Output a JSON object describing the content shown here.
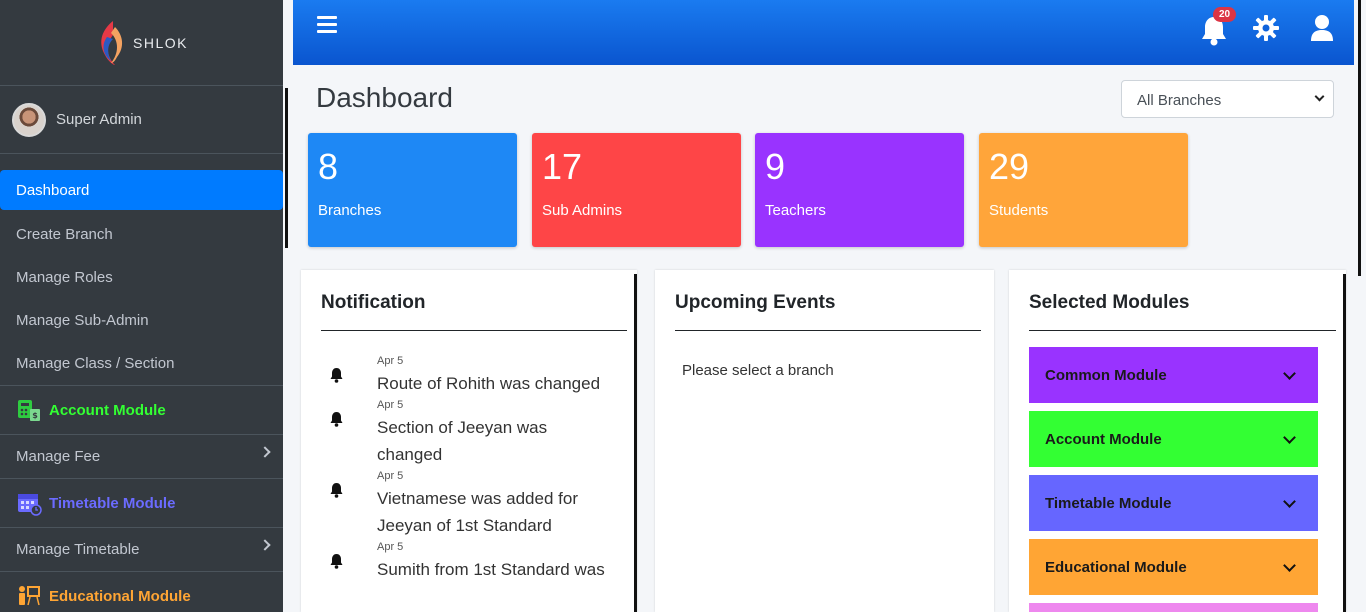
{
  "brand": {
    "name": "SHLOK"
  },
  "user": {
    "name": "Super Admin"
  },
  "sidebar": {
    "items": [
      {
        "label": "Dashboard"
      },
      {
        "label": "Create Branch"
      },
      {
        "label": "Manage Roles"
      },
      {
        "label": "Manage Sub-Admin"
      },
      {
        "label": "Manage Class / Section"
      }
    ],
    "modules": [
      {
        "label": "Account Module",
        "color": "#33ff33",
        "sub": "Manage Fee"
      },
      {
        "label": "Timetable Module",
        "color": "#6b6bff",
        "sub": "Manage Timetable"
      },
      {
        "label": "Educational Module",
        "color": "#ffa534"
      }
    ]
  },
  "topbar": {
    "notification_count": "20"
  },
  "header": {
    "title": "Dashboard",
    "branch_select": "All Branches"
  },
  "stats": [
    {
      "value": "8",
      "label": "Branches",
      "color": "#1e88f5"
    },
    {
      "value": "17",
      "label": "Sub Admins",
      "color": "#fe4547"
    },
    {
      "value": "9",
      "label": "Teachers",
      "color": "#9933ff"
    },
    {
      "value": "29",
      "label": "Students",
      "color": "#ffa53a"
    }
  ],
  "notification": {
    "title": "Notification",
    "items": [
      {
        "date": "Apr 5",
        "text": "Route of Rohith was changed"
      },
      {
        "date": "Apr 5",
        "text": "Section of Jeeyan was changed"
      },
      {
        "date": "Apr 5",
        "text": "Vietnamese was added for Jeeyan of 1st Standard"
      },
      {
        "date": "Apr 5",
        "text": "Sumith from 1st Standard was"
      }
    ]
  },
  "events": {
    "title": "Upcoming Events",
    "message": "Please select a branch"
  },
  "modules": {
    "title": "Selected Modules",
    "items": [
      {
        "label": "Common Module",
        "color": "#9933ff"
      },
      {
        "label": "Account Module",
        "color": "#33ff33"
      },
      {
        "label": "Timetable Module",
        "color": "#6666ff"
      },
      {
        "label": "Educational Module",
        "color": "#ffa534"
      }
    ]
  }
}
